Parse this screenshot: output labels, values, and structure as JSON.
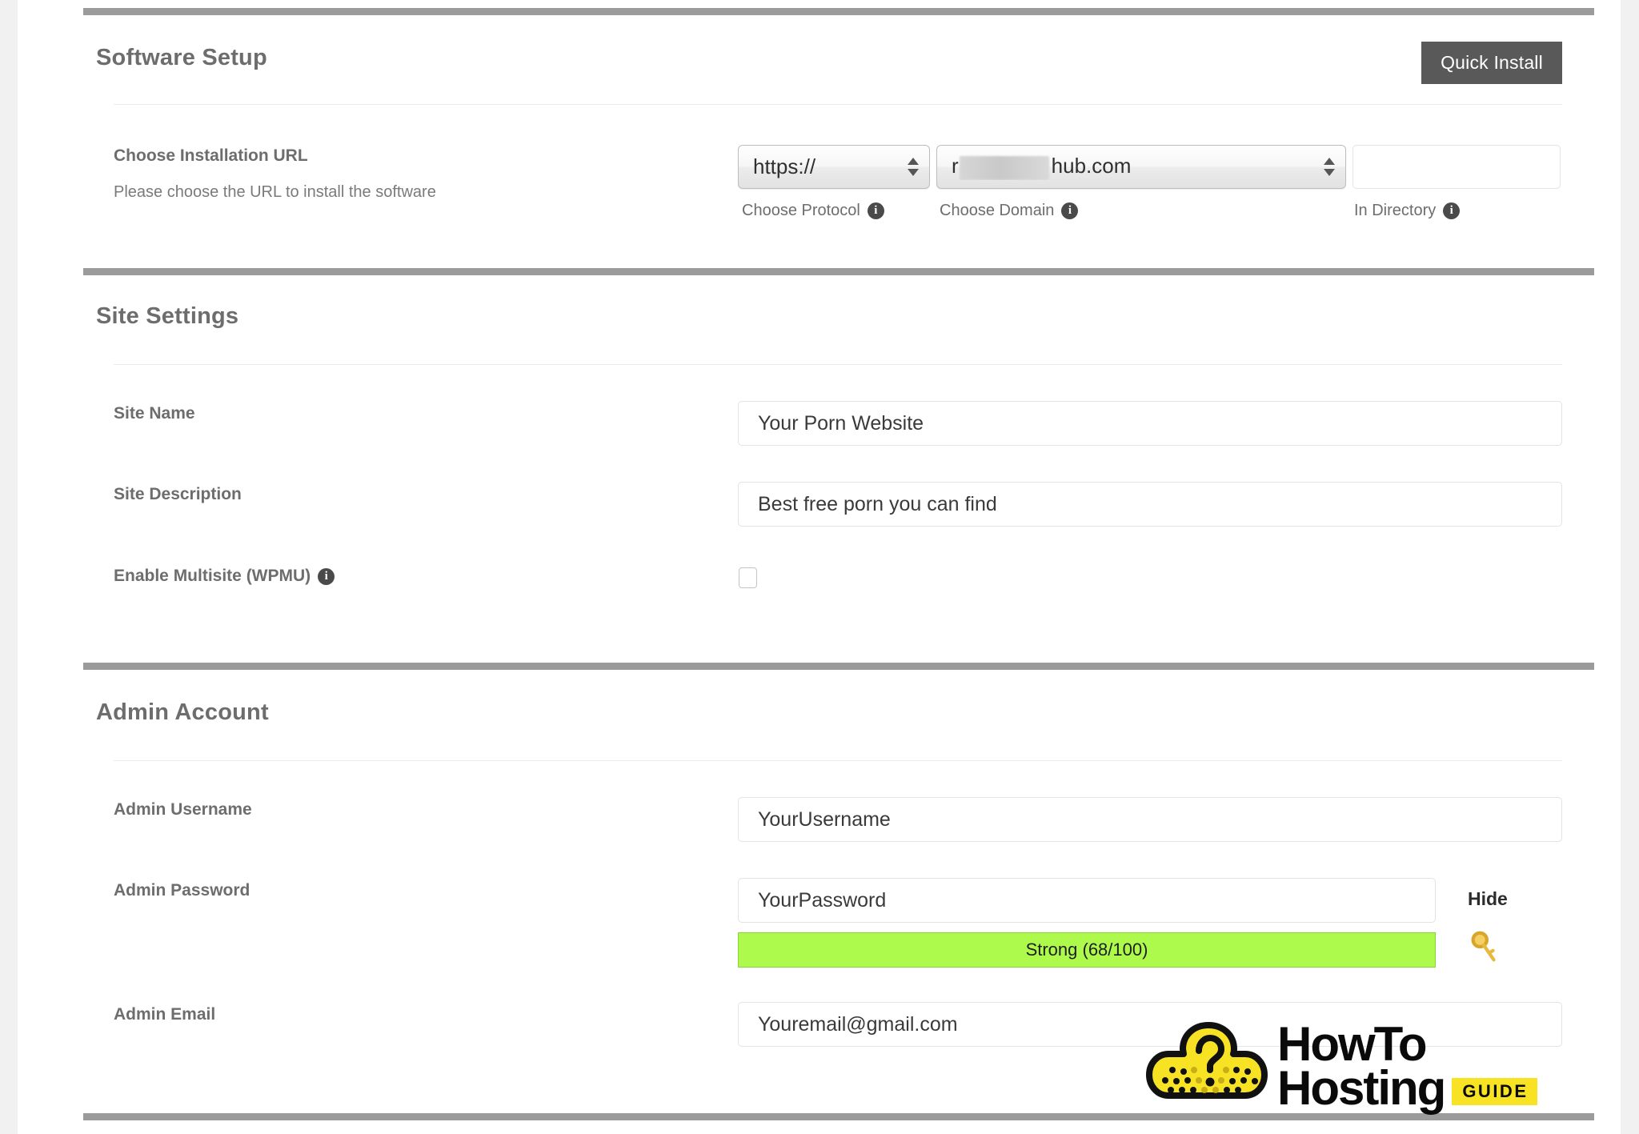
{
  "colors": {
    "divider": "#9b9b9b",
    "quick_install_bg": "#595959",
    "strength_bar": "#adfa4c",
    "logo_yellow": "#f7e323",
    "heading_text": "#6d6d6d"
  },
  "software_setup": {
    "title": "Software Setup",
    "quick_install_label": "Quick Install",
    "install_url": {
      "label": "Choose Installation URL",
      "sublabel": "Please choose the URL to install the software",
      "protocol": {
        "value": "https://",
        "caption": "Choose Protocol",
        "info_glyph": "i"
      },
      "domain": {
        "value_prefix": "r",
        "value_suffix": "hub.com",
        "redacted": true,
        "caption": "Choose Domain",
        "info_glyph": "i"
      },
      "directory": {
        "value": "",
        "placeholder": "",
        "caption": "In Directory",
        "info_glyph": "i"
      }
    }
  },
  "site_settings": {
    "title": "Site Settings",
    "site_name": {
      "label": "Site Name",
      "value": "Your Porn Website"
    },
    "site_description": {
      "label": "Site Description",
      "value": "Best free porn you can find"
    },
    "multisite": {
      "label": "Enable Multisite (WPMU)",
      "info_glyph": "i",
      "checked": false
    }
  },
  "admin_account": {
    "title": "Admin Account",
    "username": {
      "label": "Admin Username",
      "value": "YourUsername"
    },
    "password": {
      "label": "Admin Password",
      "value": "YourPassword",
      "strength_text": "Strong (68/100)",
      "strength_score": 68,
      "strength_max": 100,
      "hide_label": "Hide",
      "generate_icon": "key-icon"
    },
    "email": {
      "label": "Admin Email",
      "value": "Youremail@gmail.com"
    }
  },
  "watermark": {
    "line1": "HowTo",
    "line2": "Hosting",
    "badge": "GUIDE",
    "icon": "cloud-question-icon"
  }
}
